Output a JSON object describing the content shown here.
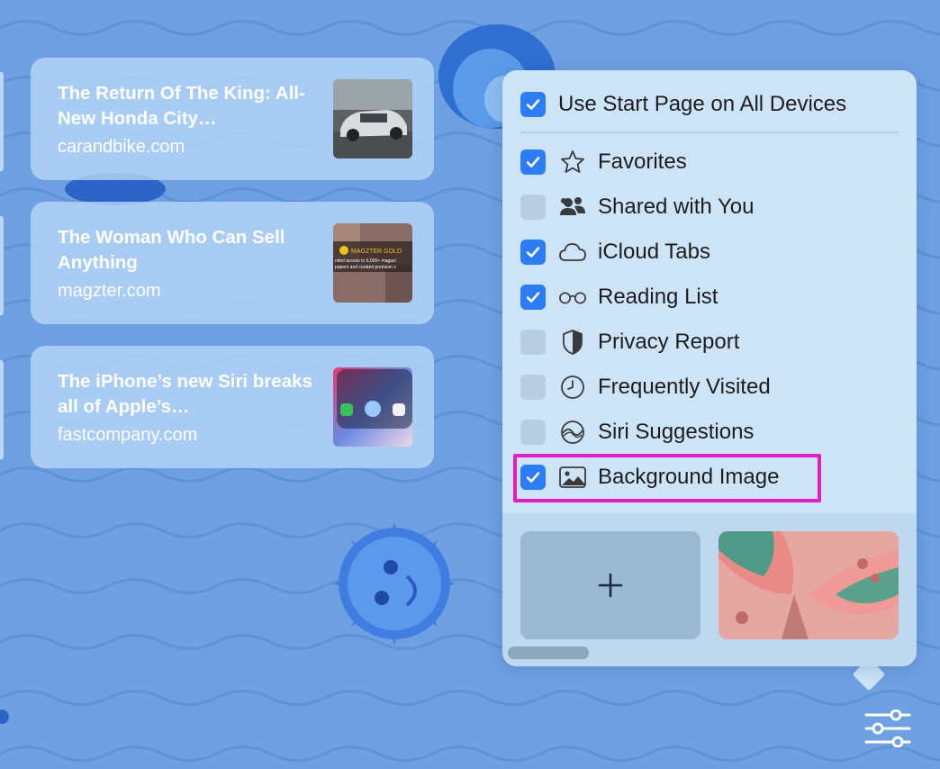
{
  "reading_list": [
    {
      "title": "The Return Of The King: All-New Honda City…",
      "domain": "carandbike.com",
      "thumb_icon": "car-photo-thumbnail"
    },
    {
      "title": "The Woman Who Can Sell Anything",
      "domain": "magzter.com",
      "thumb_icon": "magazine-thumbnail",
      "thumb_text": [
        "MAGZTER GOLD",
        "nited access to 5,000+ magazi",
        "papers and curated premium s"
      ]
    },
    {
      "title": "The iPhone’s new Siri breaks all of Apple’s…",
      "domain": "fastcompany.com",
      "thumb_icon": "iphone-siri-thumbnail"
    }
  ],
  "popover": {
    "sync": {
      "label": "Use Start Page on All Devices",
      "checked": true
    },
    "options": [
      {
        "label": "Favorites",
        "icon": "star-icon",
        "checked": true
      },
      {
        "label": "Shared with You",
        "icon": "people-icon",
        "checked": false
      },
      {
        "label": "iCloud Tabs",
        "icon": "cloud-icon",
        "checked": true
      },
      {
        "label": "Reading List",
        "icon": "glasses-icon",
        "checked": true
      },
      {
        "label": "Privacy Report",
        "icon": "shield-icon",
        "checked": false
      },
      {
        "label": "Frequently Visited",
        "icon": "clock-icon",
        "checked": false
      },
      {
        "label": "Siri Suggestions",
        "icon": "siri-icon",
        "checked": false
      },
      {
        "label": "Background Image",
        "icon": "photo-icon",
        "checked": true
      }
    ],
    "highlighted_option": "Background Image",
    "gallery": {
      "add_label": "+",
      "image_icon": "butterfly-wallpaper"
    }
  },
  "colors": {
    "background": "#6ea0e2",
    "popover": "#cde4f7",
    "checkbox_on": "#2b7cf5",
    "highlight": "#e21dc4"
  },
  "settings_icon": "sliders-icon"
}
